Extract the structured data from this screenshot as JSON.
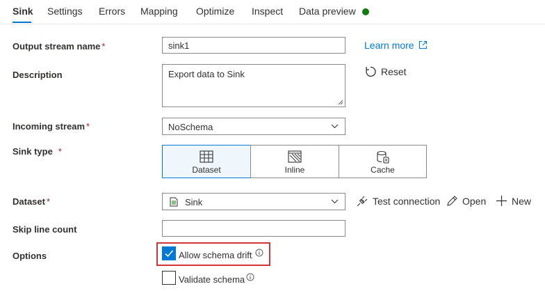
{
  "tabs": [
    {
      "label": "Sink",
      "active": true
    },
    {
      "label": "Settings"
    },
    {
      "label": "Errors"
    },
    {
      "label": "Mapping"
    },
    {
      "label": "Optimize"
    },
    {
      "label": "Inspect"
    },
    {
      "label": "Data preview"
    }
  ],
  "colors": {
    "accent": "#0078d4",
    "status_dot": "#107c10",
    "required": "#a4262c",
    "highlight": "#d13438"
  },
  "form": {
    "output_stream_name": {
      "label": "Output stream name",
      "required_mark": "*",
      "value": "sink1"
    },
    "learn_more": "Learn more",
    "description": {
      "label": "Description",
      "value": "Export data to Sink"
    },
    "reset": "Reset",
    "incoming_stream": {
      "label": "Incoming stream",
      "required_mark": "*",
      "value": "NoSchema"
    },
    "sink_type": {
      "label": "Sink type",
      "required_mark": "*",
      "options": [
        "Dataset",
        "Inline",
        "Cache"
      ],
      "selected": "Dataset"
    },
    "dataset": {
      "label": "Dataset",
      "required_mark": "*",
      "value": "Sink",
      "test_connection": "Test connection",
      "open": "Open",
      "new": "New"
    },
    "skip_line_count": {
      "label": "Skip line count",
      "value": ""
    },
    "options": {
      "label": "Options",
      "allow_schema_drift": {
        "label": "Allow schema drift",
        "checked": true
      },
      "validate_schema": {
        "label": "Validate schema",
        "checked": false
      }
    }
  },
  "icons": [
    "external-link-icon",
    "reset-icon",
    "chevron-down-icon",
    "dataset-table-icon",
    "inline-icon",
    "cache-icon",
    "file-icon",
    "plug-icon",
    "pencil-icon",
    "plus-icon",
    "check-icon",
    "info-icon"
  ]
}
